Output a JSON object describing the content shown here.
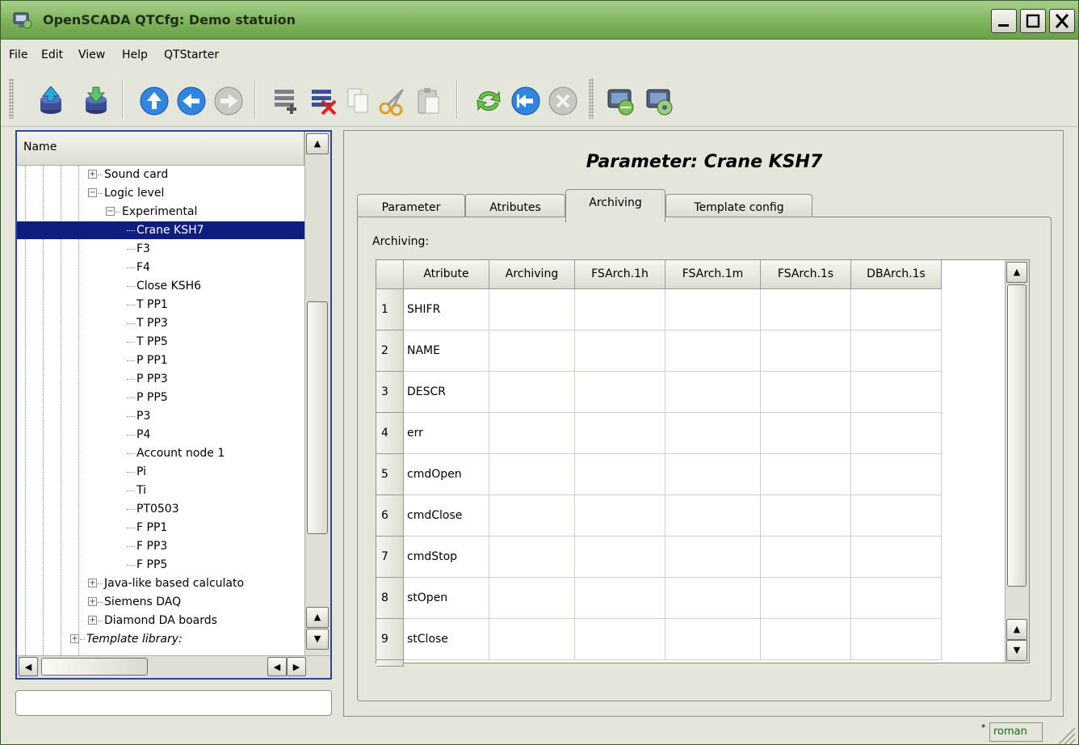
{
  "window": {
    "title": "OpenSCADA QTCfg: Demo statuion"
  },
  "menu": [
    "File",
    "Edit",
    "View",
    "Help",
    "QTStarter"
  ],
  "toolbar": {
    "buttons": [
      "load-db-icon",
      "save-db-icon",
      "up-icon",
      "back-icon",
      "forward-icon",
      "add-item-icon",
      "delete-item-icon",
      "copy-icon",
      "cut-icon",
      "paste-icon",
      "refresh-icon",
      "start-icon",
      "stop-icon",
      "qt-starter-icon",
      "qt-config-icon"
    ]
  },
  "tree": {
    "header": "Name",
    "items": [
      {
        "label": "Sound card",
        "level": 4,
        "expander": "+"
      },
      {
        "label": "Logic level",
        "level": 4,
        "expander": "−"
      },
      {
        "label": "Experimental",
        "level": 5,
        "expander": "−"
      },
      {
        "label": "Crane KSH7",
        "level": 6,
        "selected": true
      },
      {
        "label": "F3",
        "level": 6
      },
      {
        "label": "F4",
        "level": 6
      },
      {
        "label": "Close KSH6",
        "level": 6
      },
      {
        "label": "T PP1",
        "level": 6
      },
      {
        "label": "T PP3",
        "level": 6
      },
      {
        "label": "T PP5",
        "level": 6
      },
      {
        "label": "P PP1",
        "level": 6
      },
      {
        "label": "P PP3",
        "level": 6
      },
      {
        "label": "P PP5",
        "level": 6
      },
      {
        "label": "P3",
        "level": 6
      },
      {
        "label": "P4",
        "level": 6
      },
      {
        "label": "Account node 1",
        "level": 6
      },
      {
        "label": "Pi",
        "level": 6
      },
      {
        "label": "Ti",
        "level": 6
      },
      {
        "label": "PT0503",
        "level": 6
      },
      {
        "label": "F PP1",
        "level": 6
      },
      {
        "label": "F PP3",
        "level": 6
      },
      {
        "label": "F PP5",
        "level": 6
      },
      {
        "label": "Java-like based calculato",
        "level": 4,
        "expander": "+"
      },
      {
        "label": "Siemens DAQ",
        "level": 4,
        "expander": "+"
      },
      {
        "label": "Diamond DA boards",
        "level": 4,
        "expander": "+"
      },
      {
        "label": "Template library:",
        "level": 3,
        "expander": "+",
        "italic": true
      }
    ]
  },
  "status": {
    "text": "",
    "user": "roman",
    "marker": "*"
  },
  "page": {
    "title": "Parameter: Crane KSH7",
    "tabs": [
      "Parameter",
      "Atributes",
      "Archiving",
      "Template config"
    ],
    "active_tab": "Archiving",
    "section_label": "Archiving:"
  },
  "table": {
    "columns": [
      "Atribute",
      "Archiving",
      "FSArch.1h",
      "FSArch.1m",
      "FSArch.1s",
      "DBArch.1s"
    ],
    "rows": [
      {
        "n": "1",
        "attr": "SHIFR"
      },
      {
        "n": "2",
        "attr": "NAME"
      },
      {
        "n": "3",
        "attr": "DESCR"
      },
      {
        "n": "4",
        "attr": "err"
      },
      {
        "n": "5",
        "attr": "cmdOpen"
      },
      {
        "n": "6",
        "attr": "cmdClose"
      },
      {
        "n": "7",
        "attr": "cmdStop"
      },
      {
        "n": "8",
        "attr": "stOpen"
      },
      {
        "n": "9",
        "attr": "stClose"
      }
    ]
  },
  "colors": {
    "title_bar": "#7fb35c",
    "selection": "#0f1e7e",
    "frame": "#e5e6db"
  }
}
